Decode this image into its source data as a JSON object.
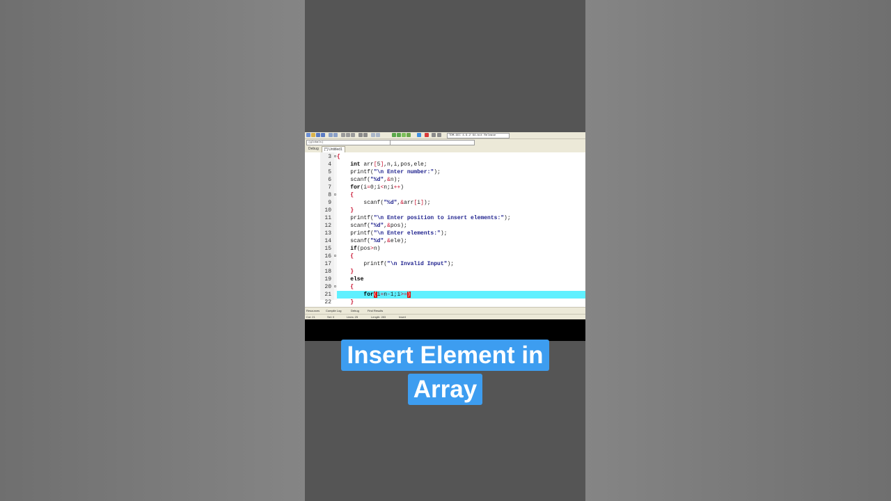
{
  "caption": {
    "line1": "Insert Element in",
    "line2": "Array"
  },
  "toolbar": {
    "compiler": "TDM-GCC 4.9.2 64-bit Release"
  },
  "scope": {
    "value": "(globals)"
  },
  "tabs": [
    {
      "label": "Debug"
    },
    {
      "label": "[*] Untitled1"
    }
  ],
  "editor": {
    "lines": [
      {
        "num": "3",
        "text": "{"
      },
      {
        "num": "4",
        "text": "    int arr[5],n,i,pos,ele;"
      },
      {
        "num": "5",
        "text": "    printf(\"\\n Enter number:\");"
      },
      {
        "num": "6",
        "text": "    scanf(\"%d\",&n);"
      },
      {
        "num": "7",
        "text": "    for(i=0;i<n;i++)"
      },
      {
        "num": "8",
        "text": "    {"
      },
      {
        "num": "9",
        "text": "        scanf(\"%d\",&arr[i]);"
      },
      {
        "num": "10",
        "text": "    }"
      },
      {
        "num": "11",
        "text": "    printf(\"\\n Enter position to insert elements:\");"
      },
      {
        "num": "12",
        "text": "    scanf(\"%d\",&pos);"
      },
      {
        "num": "13",
        "text": "    printf(\"\\n Enter elements:\");"
      },
      {
        "num": "14",
        "text": "    scanf(\"%d\",&ele);"
      },
      {
        "num": "15",
        "text": "    if(pos>n)"
      },
      {
        "num": "16",
        "text": "    {"
      },
      {
        "num": "17",
        "text": "        printf(\"\\n Invalid Input\");"
      },
      {
        "num": "18",
        "text": "    }"
      },
      {
        "num": "19",
        "text": "    else"
      },
      {
        "num": "20",
        "text": "    {"
      },
      {
        "num": "21",
        "text": "        for(i=n-1;i>=)"
      },
      {
        "num": "22",
        "text": "    }"
      }
    ]
  },
  "bottom_tabs": [
    {
      "label": "Resources"
    },
    {
      "label": "Compile Log"
    },
    {
      "label": "Debug"
    },
    {
      "label": "Find Results"
    }
  ],
  "status": {
    "col": "Col: 21",
    "sel": "Sel: 0",
    "lines": "Lines: 25",
    "length": "Length: 283",
    "mode": "Insert"
  },
  "colors": {
    "highlight": "#5ff0ff",
    "caption_bg": "#3d9df0"
  }
}
